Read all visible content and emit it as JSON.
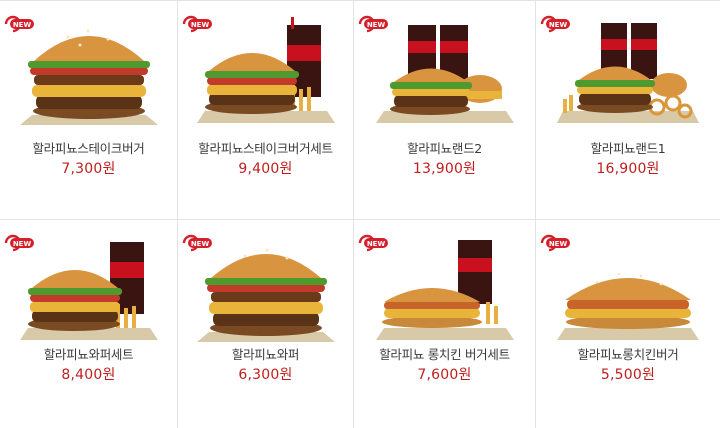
{
  "colors": {
    "price": "#c01e1e",
    "badge": "#d4202a",
    "divider": "#e3e3e3"
  },
  "badge_label": "NEW",
  "products": [
    {
      "name": "할라피뇨스테이크버거",
      "price": "7,300원",
      "kind": "single-burger",
      "new": true
    },
    {
      "name": "할라피뇨스테이크버거세트",
      "price": "9,400원",
      "kind": "burger-set",
      "new": true
    },
    {
      "name": "할라피뇨랜드2",
      "price": "13,900원",
      "kind": "burger-combo",
      "new": true
    },
    {
      "name": "할라피뇨랜드1",
      "price": "16,900원",
      "kind": "burger-combo-onion",
      "new": true
    },
    {
      "name": "할라피뇨와퍼세트",
      "price": "8,400원",
      "kind": "burger-set",
      "new": true
    },
    {
      "name": "할라피뇨와퍼",
      "price": "6,300원",
      "kind": "single-burger",
      "new": true
    },
    {
      "name": "할라피뇨 롱치킨 버거세트",
      "price": "7,600원",
      "kind": "long-burger-set",
      "new": true
    },
    {
      "name": "할라피뇨롱치킨버거",
      "price": "5,500원",
      "kind": "long-burger",
      "new": true
    }
  ]
}
